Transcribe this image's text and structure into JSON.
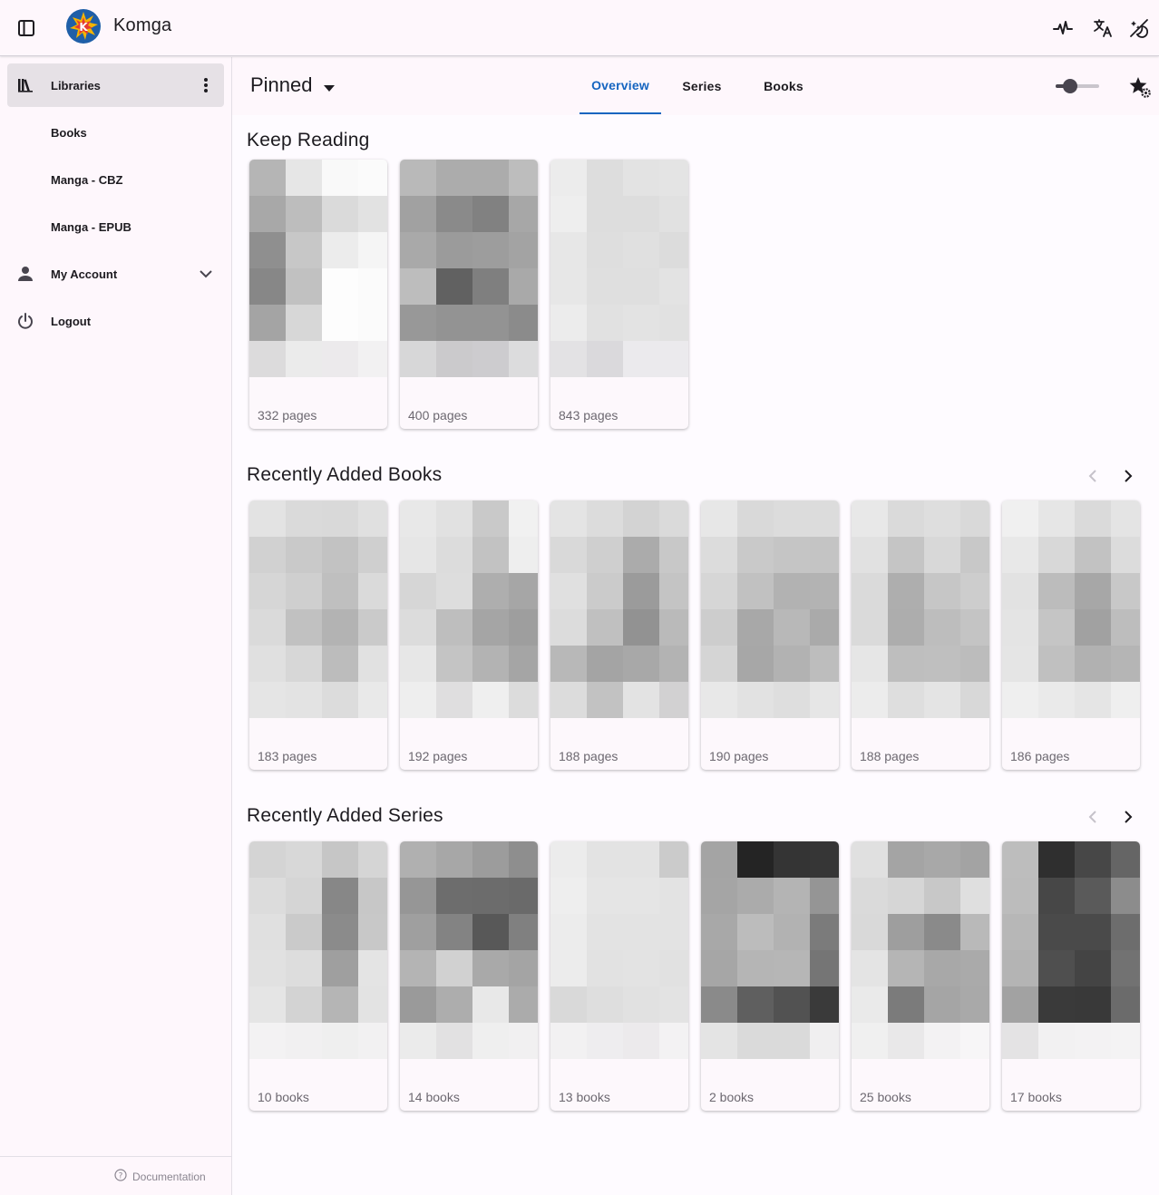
{
  "app": {
    "title": "Komga"
  },
  "sidebar": {
    "items": [
      {
        "label": "Libraries"
      },
      {
        "label": "Books"
      },
      {
        "label": "Manga - CBZ"
      },
      {
        "label": "Manga - EPUB"
      },
      {
        "label": "My Account"
      },
      {
        "label": "Logout"
      }
    ],
    "footer": {
      "documentation": "Documentation"
    }
  },
  "toolbar": {
    "library_selector": "Pinned",
    "tabs": [
      {
        "label": "Overview"
      },
      {
        "label": "Series"
      },
      {
        "label": "Books"
      }
    ],
    "size_slider_value": 0.25
  },
  "sections": {
    "keep_reading": {
      "title": "Keep Reading",
      "cards": [
        {
          "caption": "332 pages"
        },
        {
          "caption": "400 pages"
        },
        {
          "caption": "843 pages"
        }
      ]
    },
    "recently_added_books": {
      "title": "Recently Added Books",
      "cards": [
        {
          "caption": "183 pages"
        },
        {
          "caption": "192 pages"
        },
        {
          "caption": "188 pages"
        },
        {
          "caption": "190 pages"
        },
        {
          "caption": "188 pages"
        },
        {
          "caption": "186 pages"
        }
      ]
    },
    "recently_added_series": {
      "title": "Recently Added Series",
      "cards": [
        {
          "caption": "10 books"
        },
        {
          "caption": "14 books"
        },
        {
          "caption": "13 books"
        },
        {
          "caption": "2 books"
        },
        {
          "caption": "25 books"
        },
        {
          "caption": "17 books"
        }
      ]
    }
  },
  "colors": {
    "accent": "#1565c0",
    "appbar_bg": "#fef7fc",
    "active_nav_bg": "#e6e1e6",
    "logo_ring": "#1f5fa8",
    "logo_burst": "#f5b400",
    "logo_center": "#e53935"
  }
}
